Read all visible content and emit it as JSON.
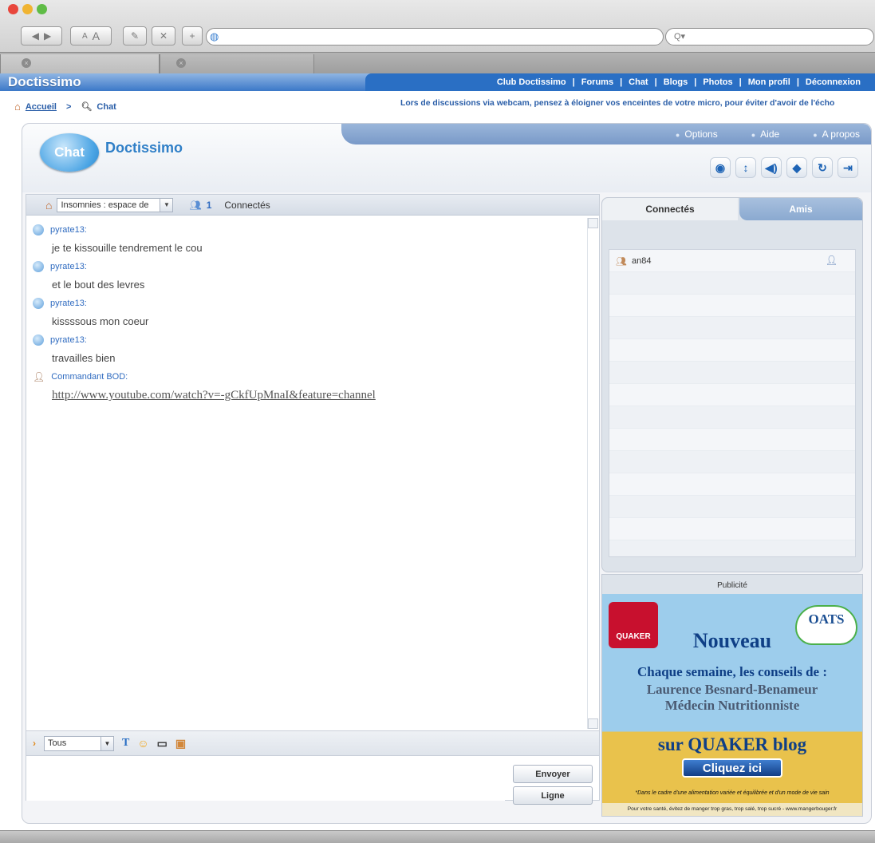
{
  "browser": {
    "url": "",
    "search_placeholder": "Q▾",
    "tab_close": "×"
  },
  "site": {
    "logo": "Doctissimo",
    "nav": [
      "Club Doctissimo",
      "Forums",
      "Chat",
      "Blogs",
      "Photos",
      "Mon profil",
      "Déconnexion"
    ],
    "nav_sep": "|",
    "breadcrumb": {
      "home": "Accueil",
      "sep": ">",
      "current": "Chat"
    },
    "tip": "Lors de discussions via webcam, pensez à éloigner vos enceintes de votre micro, pour éviter d'avoir de l'écho"
  },
  "chat": {
    "logo_bubble": "Chat",
    "logo_title": "Doctissimo",
    "options": [
      "Options",
      "Aide",
      "A propos"
    ],
    "room": "Insomnies : espace de",
    "connected_count": "1",
    "connected_label": "Connectés",
    "messages": [
      {
        "author": "pyrate13:",
        "text": "je te kissouille tendrement le cou"
      },
      {
        "author": "pyrate13:",
        "text": "et le bout des levres"
      },
      {
        "author": "pyrate13:",
        "text": "kissssous mon coeur"
      },
      {
        "author": "pyrate13:",
        "text": "travailles bien"
      },
      {
        "author": "Commandant BOD:",
        "text": "http://www.youtube.com/watch?v=-gCkfUpMnaI&feature=channel"
      }
    ],
    "recipient": "Tous",
    "send_button": "Envoyer",
    "line_button": "Ligne"
  },
  "sidebar": {
    "tabs": [
      "Connectés",
      "Amis"
    ],
    "users": [
      "an84"
    ]
  },
  "ad": {
    "label": "Publicité",
    "brand": "QUAKER",
    "oats": "OATS",
    "headline": "Nouveau",
    "line1": "Chaque semaine, les conseils de :",
    "line2": "Laurence Besnard-Benameur",
    "line3": "Médecin Nutritionniste",
    "blog": "sur QUAKER blog",
    "cta": "Cliquez ici",
    "foot1": "*Dans le cadre d'une alimentation variée et équilibrée et d'un mode de vie sain",
    "foot2": "Pour votre santé, évitez de manger trop gras, trop salé, trop sucré - www.mangerbouger.fr"
  },
  "colors": {
    "brand_blue": "#2a6fc4",
    "link_blue": "#2f6bc0",
    "panel_bg": "#f3f4f7"
  }
}
